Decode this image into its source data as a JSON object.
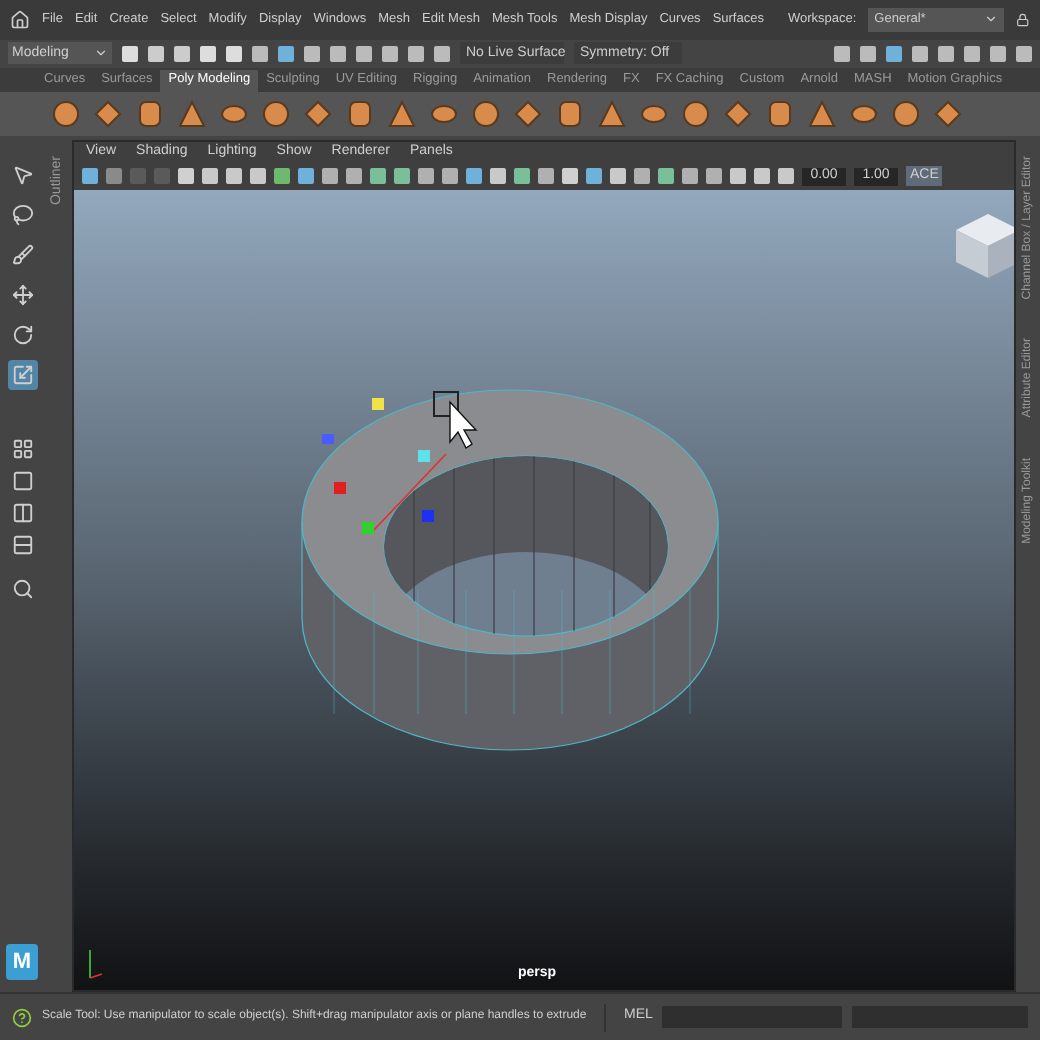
{
  "menu_bar": {
    "items": [
      "File",
      "Edit",
      "Create",
      "Select",
      "Modify",
      "Display",
      "Windows",
      "Mesh",
      "Edit Mesh",
      "Mesh Tools",
      "Mesh Display",
      "Curves",
      "Surfaces"
    ],
    "workspace_label": "Workspace:",
    "workspace": "General*"
  },
  "status_line": {
    "mode": "Modeling",
    "live_surface": "No Live Surface",
    "symmetry": "Symmetry: Off"
  },
  "shelf": {
    "tabs": [
      {
        "label": "Curves",
        "selected": false
      },
      {
        "label": "Surfaces",
        "selected": false
      },
      {
        "label": "Poly Modeling",
        "selected": true
      },
      {
        "label": "Sculpting",
        "selected": false
      },
      {
        "label": "UV Editing",
        "selected": false
      },
      {
        "label": "Rigging",
        "selected": false
      },
      {
        "label": "Animation",
        "selected": false
      },
      {
        "label": "Rendering",
        "selected": false
      },
      {
        "label": "FX",
        "selected": false
      },
      {
        "label": "FX Caching",
        "selected": false
      },
      {
        "label": "Custom",
        "selected": false
      },
      {
        "label": "Arnold",
        "selected": false
      },
      {
        "label": "MASH",
        "selected": false
      },
      {
        "label": "Motion Graphics",
        "selected": false
      }
    ]
  },
  "toolbox": {
    "tools": [
      {
        "kind": "select",
        "selected": false
      },
      {
        "kind": "lasso",
        "selected": false
      },
      {
        "kind": "paint",
        "selected": false
      },
      {
        "kind": "move",
        "selected": false
      },
      {
        "kind": "rotate",
        "selected": false
      },
      {
        "kind": "scale",
        "selected": true
      }
    ]
  },
  "left_panel_label": "Outliner",
  "viewport": {
    "menus": [
      "View",
      "Shading",
      "Lighting",
      "Show",
      "Renderer",
      "Panels"
    ],
    "fields": [
      "0.00",
      "1.00"
    ],
    "color_space": "ACE",
    "camera": "persp"
  },
  "right_tabs": [
    "Channel Box / Layer Editor",
    "Attribute Editor",
    "Modeling Toolkit"
  ],
  "app_logo": "M",
  "help_line": {
    "message": "Scale Tool: Use manipulator to scale object(s). Shift+drag manipulator axis or plane handles to extrude"
  },
  "command_line": {
    "language": "MEL"
  }
}
